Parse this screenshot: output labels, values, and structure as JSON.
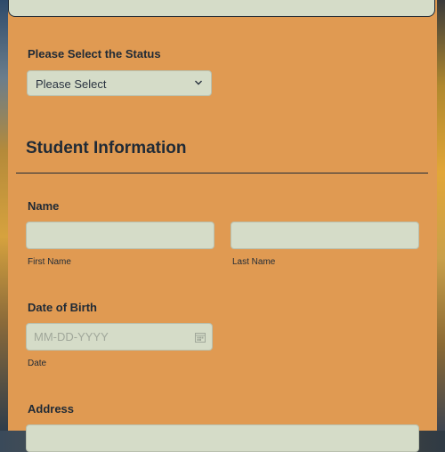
{
  "status": {
    "label": "Please Select the Status",
    "selected": "Please Select"
  },
  "student_info": {
    "title": "Student Information"
  },
  "name": {
    "label": "Name",
    "first_sublabel": "First Name",
    "last_sublabel": "Last Name"
  },
  "dob": {
    "label": "Date of Birth",
    "placeholder": "MM-DD-YYYY",
    "sublabel": "Date"
  },
  "address": {
    "label": "Address"
  },
  "colors": {
    "card": "#e09a52",
    "field": "#d5dcc8",
    "text": "#1f2a36"
  }
}
